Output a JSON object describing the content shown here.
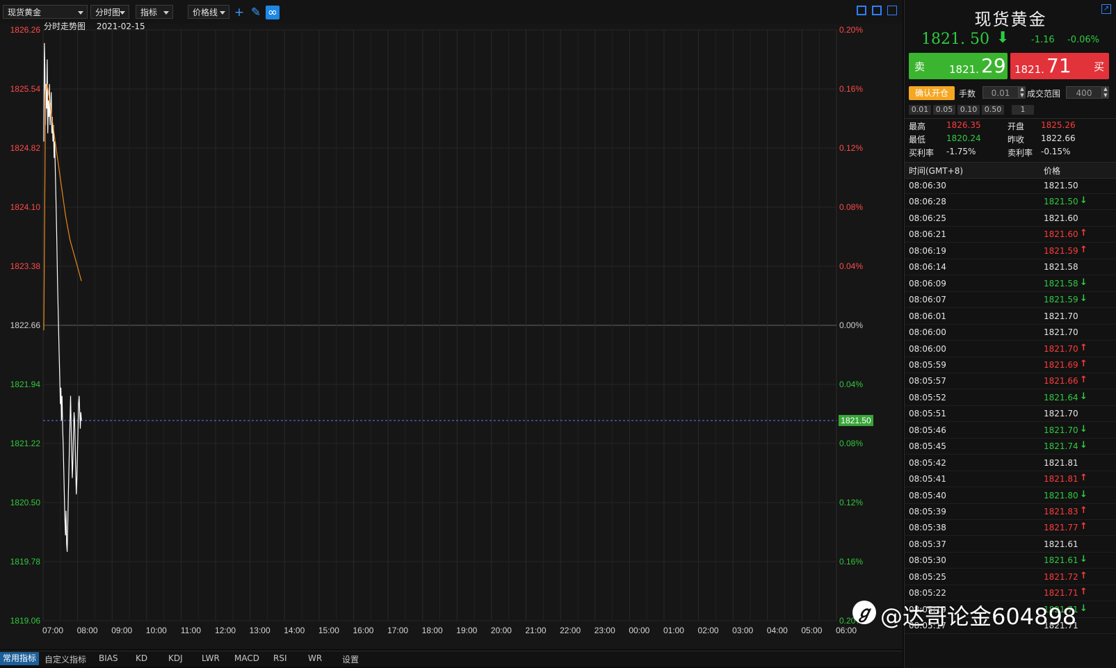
{
  "toolbar": {
    "symbol_select": "现货黄金",
    "chart_type": "分时图",
    "indicator": "指标",
    "price_line": "价格线"
  },
  "chart_info": {
    "title": "分时走势图",
    "date": "2021-02-15"
  },
  "bottom_tabs": [
    "常用指标",
    "自定义指标",
    "BIAS",
    "KD",
    "KDJ",
    "LWR",
    "MACD",
    "RSI",
    "WR",
    "设置"
  ],
  "colors": {
    "up": "#ff3b3b",
    "down": "#2ecc40",
    "price_line": "#ffffff",
    "avg_line": "#e8891e",
    "current_line": "#5b7cff"
  },
  "chart_data": {
    "type": "line",
    "price_axis_labels": [
      "1826.26",
      "1825.54",
      "1824.82",
      "1824.10",
      "1823.38",
      "1822.66",
      "1821.94",
      "1821.22",
      "1820.50",
      "1819.78",
      "1819.06"
    ],
    "percent_axis_labels": [
      "0.20%",
      "0.16%",
      "0.12%",
      "0.08%",
      "0.04%",
      "0.00%",
      "0.04%",
      "0.08%",
      "0.12%",
      "0.16%",
      "0.20%"
    ],
    "x_tick_labels": [
      "07:00",
      "08:00",
      "09:00",
      "10:00",
      "11:00",
      "12:00",
      "13:00",
      "14:00",
      "15:00",
      "16:00",
      "17:00",
      "18:00",
      "19:00",
      "20:00",
      "21:00",
      "22:00",
      "23:00",
      "00:00",
      "01:00",
      "02:00",
      "03:00",
      "04:00",
      "05:00",
      "06:00"
    ],
    "ylim": [
      1819.06,
      1826.26
    ],
    "reference_price": 1822.66,
    "current_price": 1821.5,
    "current_price_label": "1821.50",
    "grid": true,
    "series": [
      {
        "role": "price",
        "x_minutes": [
          0,
          1,
          2,
          3,
          4,
          5,
          6,
          7,
          8,
          9,
          10,
          11,
          12,
          13,
          14,
          15,
          16,
          17,
          18,
          19,
          20,
          21,
          22,
          23,
          24,
          25,
          26,
          27,
          28,
          29,
          30,
          31,
          32,
          33,
          34,
          35,
          36,
          37,
          38,
          39,
          40,
          41,
          42,
          43,
          44,
          45,
          46,
          47,
          48,
          49,
          50,
          51,
          52,
          53,
          54,
          55,
          56,
          57,
          58,
          59,
          60,
          61,
          62,
          63,
          64,
          65,
          66
        ],
        "values": [
          1824.9,
          1826.1,
          1825.8,
          1825.1,
          1825.6,
          1825.3,
          1825.9,
          1825.0,
          1825.4,
          1825.2,
          1825.6,
          1825.1,
          1825.3,
          1825.5,
          1825.0,
          1825.2,
          1824.9,
          1825.1,
          1824.7,
          1824.9,
          1824.6,
          1824.3,
          1824.0,
          1823.6,
          1823.2,
          1822.9,
          1822.6,
          1822.3,
          1822.0,
          1821.7,
          1821.9,
          1821.5,
          1821.8,
          1821.4,
          1821.2,
          1820.9,
          1820.6,
          1820.3,
          1820.1,
          1820.4,
          1820.0,
          1819.9,
          1820.2,
          1820.6,
          1820.9,
          1821.2,
          1821.5,
          1821.8,
          1821.4,
          1821.1,
          1820.8,
          1821.0,
          1821.3,
          1821.6,
          1821.5,
          1821.2,
          1820.9,
          1820.6,
          1820.8,
          1821.1,
          1821.4,
          1821.7,
          1821.8,
          1821.6,
          1821.4,
          1821.6,
          1821.5
        ]
      },
      {
        "role": "average",
        "x_minutes": [
          0,
          3,
          6,
          10,
          14,
          18,
          22,
          26,
          30,
          34,
          38,
          42,
          46,
          50,
          54,
          58,
          62,
          66
        ],
        "values": [
          1822.6,
          1825.5,
          1825.6,
          1825.4,
          1825.2,
          1825.0,
          1824.8,
          1824.6,
          1824.4,
          1824.2,
          1824.0,
          1823.85,
          1823.7,
          1823.6,
          1823.5,
          1823.4,
          1823.3,
          1823.2
        ]
      }
    ]
  },
  "panel": {
    "symbol_title": "现货黄金",
    "last_price": "1821. 50",
    "change": "-1.16",
    "change_pct": "-0.06%",
    "sell": {
      "label": "卖",
      "small": "1821.",
      "big": "29"
    },
    "buy": {
      "label": "买",
      "small": "1821.",
      "big": "71"
    },
    "confirm_label": "确认开仓",
    "lots_label": "手数",
    "lots_value": "0.01",
    "range_label": "成交范围",
    "range_value": "400",
    "quick_lots": [
      "0.01",
      "0.05",
      "0.10",
      "0.50",
      "1"
    ],
    "stats": {
      "high_label": "最高",
      "high": "1826.35",
      "open_label": "开盘",
      "open": "1825.26",
      "low_label": "最低",
      "low": "1820.24",
      "prev_close_label": "昨收",
      "prev_close": "1822.66",
      "buy_rate_label": "买利率",
      "buy_rate": "-1.75%",
      "sell_rate_label": "卖利率",
      "sell_rate": "-0.15%"
    },
    "tick_header_time": "时间(GMT+8)",
    "tick_header_price": "价格",
    "ticks": [
      {
        "time": "08:06:30",
        "price": "1821.50",
        "dir": "flat"
      },
      {
        "time": "08:06:28",
        "price": "1821.50",
        "dir": "down"
      },
      {
        "time": "08:06:25",
        "price": "1821.60",
        "dir": "flat"
      },
      {
        "time": "08:06:21",
        "price": "1821.60",
        "dir": "up"
      },
      {
        "time": "08:06:19",
        "price": "1821.59",
        "dir": "up"
      },
      {
        "time": "08:06:14",
        "price": "1821.58",
        "dir": "flat"
      },
      {
        "time": "08:06:09",
        "price": "1821.58",
        "dir": "down"
      },
      {
        "time": "08:06:07",
        "price": "1821.59",
        "dir": "down"
      },
      {
        "time": "08:06:01",
        "price": "1821.70",
        "dir": "flat"
      },
      {
        "time": "08:06:00",
        "price": "1821.70",
        "dir": "flat"
      },
      {
        "time": "08:06:00",
        "price": "1821.70",
        "dir": "up"
      },
      {
        "time": "08:05:59",
        "price": "1821.69",
        "dir": "up"
      },
      {
        "time": "08:05:57",
        "price": "1821.66",
        "dir": "up"
      },
      {
        "time": "08:05:52",
        "price": "1821.64",
        "dir": "down"
      },
      {
        "time": "08:05:51",
        "price": "1821.70",
        "dir": "flat"
      },
      {
        "time": "08:05:46",
        "price": "1821.70",
        "dir": "down"
      },
      {
        "time": "08:05:45",
        "price": "1821.74",
        "dir": "down"
      },
      {
        "time": "08:05:42",
        "price": "1821.81",
        "dir": "flat"
      },
      {
        "time": "08:05:41",
        "price": "1821.81",
        "dir": "up"
      },
      {
        "time": "08:05:40",
        "price": "1821.80",
        "dir": "down"
      },
      {
        "time": "08:05:39",
        "price": "1821.83",
        "dir": "up"
      },
      {
        "time": "08:05:38",
        "price": "1821.77",
        "dir": "up"
      },
      {
        "time": "08:05:37",
        "price": "1821.61",
        "dir": "flat"
      },
      {
        "time": "08:05:30",
        "price": "1821.61",
        "dir": "down"
      },
      {
        "time": "08:05:25",
        "price": "1821.72",
        "dir": "up"
      },
      {
        "time": "08:05:22",
        "price": "1821.71",
        "dir": "up"
      },
      {
        "time": "08:05:19",
        "price": "1821.71",
        "dir": "down"
      },
      {
        "time": "08:05:17",
        "price": "1821.71",
        "dir": "flat"
      }
    ]
  },
  "watermark": "@达哥论金604898"
}
